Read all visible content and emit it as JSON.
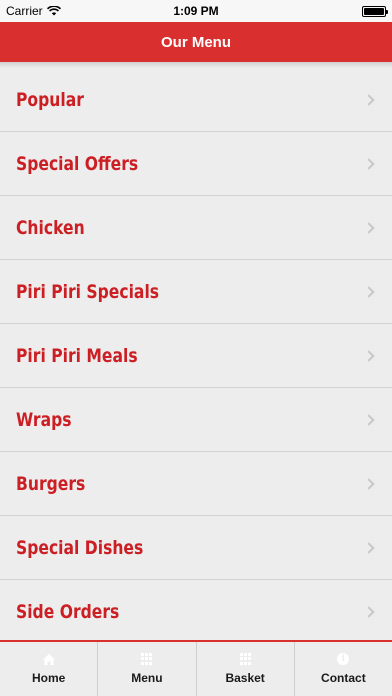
{
  "status_bar": {
    "carrier": "Carrier",
    "time": "1:09 PM"
  },
  "nav": {
    "title": "Our Menu"
  },
  "menu": {
    "items": [
      {
        "label": "Popular"
      },
      {
        "label": "Special Offers"
      },
      {
        "label": "Chicken"
      },
      {
        "label": "Piri Piri Specials"
      },
      {
        "label": "Piri Piri Meals"
      },
      {
        "label": "Wraps"
      },
      {
        "label": "Burgers"
      },
      {
        "label": "Special Dishes"
      },
      {
        "label": "Side Orders"
      }
    ]
  },
  "tabs": [
    {
      "label": "Home",
      "icon": "home-icon"
    },
    {
      "label": "Menu",
      "icon": "grid-icon"
    },
    {
      "label": "Basket",
      "icon": "grid-icon"
    },
    {
      "label": "Contact",
      "icon": "info-icon"
    }
  ],
  "colors": {
    "accent": "#d9302f",
    "item_text": "#cc1f24",
    "background": "#ededed"
  }
}
